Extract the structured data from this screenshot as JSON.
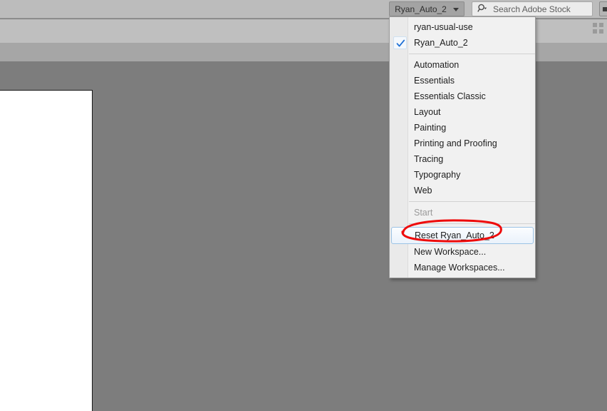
{
  "app_bar": {
    "workspace_button": {
      "label": "Ryan_Auto_2",
      "icon": "chevron-down-icon"
    },
    "search": {
      "placeholder": "Search Adobe Stock",
      "value": "",
      "icon": "search-icon"
    },
    "edge_button_icon": "window-control-icon"
  },
  "doc_bar": {
    "panel_icon": "panel-grid-icon"
  },
  "workspace_menu": {
    "groups": [
      {
        "items": [
          {
            "label": "ryan-usual-use",
            "checked": false,
            "disabled": false,
            "highlighted": false
          },
          {
            "label": "Ryan_Auto_2",
            "checked": true,
            "disabled": false,
            "highlighted": false
          }
        ]
      },
      {
        "items": [
          {
            "label": "Automation",
            "checked": false,
            "disabled": false,
            "highlighted": false
          },
          {
            "label": "Essentials",
            "checked": false,
            "disabled": false,
            "highlighted": false
          },
          {
            "label": "Essentials Classic",
            "checked": false,
            "disabled": false,
            "highlighted": false
          },
          {
            "label": "Layout",
            "checked": false,
            "disabled": false,
            "highlighted": false
          },
          {
            "label": "Painting",
            "checked": false,
            "disabled": false,
            "highlighted": false
          },
          {
            "label": "Printing and Proofing",
            "checked": false,
            "disabled": false,
            "highlighted": false
          },
          {
            "label": "Tracing",
            "checked": false,
            "disabled": false,
            "highlighted": false
          },
          {
            "label": "Typography",
            "checked": false,
            "disabled": false,
            "highlighted": false
          },
          {
            "label": "Web",
            "checked": false,
            "disabled": false,
            "highlighted": false
          }
        ]
      },
      {
        "items": [
          {
            "label": "Start",
            "checked": false,
            "disabled": true,
            "highlighted": false
          }
        ]
      },
      {
        "items": [
          {
            "label": "Reset Ryan_Auto_2",
            "checked": false,
            "disabled": false,
            "highlighted": true
          },
          {
            "label": "New Workspace...",
            "checked": false,
            "disabled": false,
            "highlighted": false
          },
          {
            "label": "Manage Workspaces...",
            "checked": false,
            "disabled": false,
            "highlighted": false
          }
        ]
      }
    ]
  },
  "annotation": {
    "shape": "red-ellipse-highlight",
    "color": "#ee0b0b",
    "targets": "Reset Ryan_Auto_2"
  },
  "colors": {
    "canvas": "#7d7d7d",
    "app_bar": "#bcbcbc",
    "control_bar": "#bfbfbf",
    "doc_bar": "#a6a6a6",
    "menu_background": "#f1f1f1",
    "artboard": "#ffffff",
    "check_accent": "#1d6fd6",
    "highlight_border": "#9cc3e5"
  }
}
